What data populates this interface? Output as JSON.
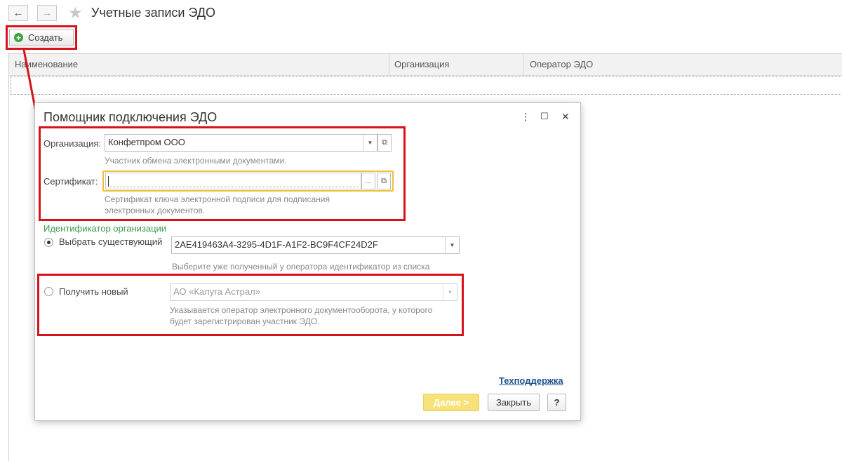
{
  "window": {
    "title": "Учетные записи ЭДО"
  },
  "toolbar": {
    "back_icon": "←",
    "forward_icon": "→",
    "favorite_icon": "★",
    "create_label": "Создать"
  },
  "table": {
    "columns": [
      "Наименование",
      "Организация",
      "Оператор ЭДО"
    ]
  },
  "dialog": {
    "title": "Помощник подключения ЭДО",
    "controls": {
      "more": "⋮",
      "maximize": "☐",
      "close": "✕"
    },
    "organization": {
      "label": "Организация:",
      "value": "Конфетпром ООО",
      "hint": "Участник обмена электронными документами."
    },
    "certificate": {
      "label": "Сертификат:",
      "value": "",
      "select_label": "...",
      "hint_line1": "Сертификат ключа электронной подписи для подписания",
      "hint_line2": "электронных документов."
    },
    "identifier": {
      "section_title": "Идентификатор организации",
      "existing": {
        "label": "Выбрать существующий",
        "value": "2AE419463A4-3295-4D1F-A1F2-BC9F4CF24D2F",
        "hint": "Выберите уже полученный у оператора идентификатор из списка",
        "selected": true
      },
      "new": {
        "label": "Получить новый",
        "value": "АО «Калуга Астрал»",
        "hint_line1": "Указывается оператор электронного документооборота, у которого",
        "hint_line2": "будет зарегистрирован участник ЭДО.",
        "selected": false
      }
    },
    "support_link": "Техподдержка",
    "buttons": {
      "next": "Далее >",
      "close": "Закрыть",
      "help": "?"
    }
  },
  "colors": {
    "highlight": "#d6131b",
    "section": "#3a9a4c",
    "next_button": "#f7e27a",
    "focus": "#f1c232"
  }
}
